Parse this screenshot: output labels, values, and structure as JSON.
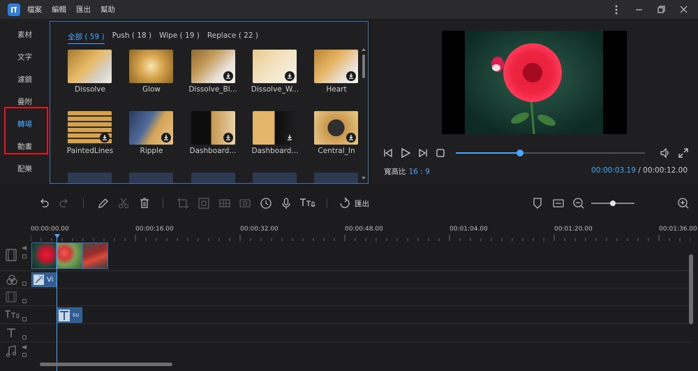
{
  "titlebar": {
    "menu": [
      "檔案",
      "編輯",
      "匯出",
      "幫助"
    ]
  },
  "categories": [
    {
      "label": "素材"
    },
    {
      "label": "文字"
    },
    {
      "label": "濾鏡"
    },
    {
      "label": "疊附"
    },
    {
      "label": "轉場",
      "active": true
    },
    {
      "label": "動畫"
    },
    {
      "label": "配樂"
    }
  ],
  "effects": {
    "tabs": [
      {
        "label": "全部 ( 59 )",
        "active": true
      },
      {
        "label": "Push ( 18 )"
      },
      {
        "label": "Wipe ( 19 )"
      },
      {
        "label": "Replace ( 22 )"
      }
    ],
    "items": [
      {
        "name": "Dissolve",
        "downloadable": false
      },
      {
        "name": "Glow",
        "downloadable": false
      },
      {
        "name": "Dissolve_Bl...",
        "downloadable": true
      },
      {
        "name": "Dissolve_W...",
        "downloadable": true
      },
      {
        "name": "Heart",
        "downloadable": true
      },
      {
        "name": "PaintedLines",
        "downloadable": true
      },
      {
        "name": "Ripple",
        "downloadable": true
      },
      {
        "name": "Dashboard...",
        "downloadable": true
      },
      {
        "name": "Dashboard...",
        "downloadable": true
      },
      {
        "name": "Central_In",
        "downloadable": true
      }
    ]
  },
  "preview": {
    "aspect_label": "寬高比",
    "aspect_value": "16 : 9",
    "current_time": "00:00:03.19",
    "separator": "/",
    "total_time": "00:00:12.00",
    "progress_fraction": 0.34
  },
  "toolbar": {
    "export_label": "匯出",
    "zoom_fraction": 0.5
  },
  "timeline": {
    "ruler_labels": [
      "00:00:00.00",
      "00:00:16.00",
      "00:00:32.00",
      "00:00:48.00",
      "00:01:04.00",
      "00:01:20.00",
      "00:01:36.00"
    ],
    "effect_clip_label": "Vi",
    "text_clip_label": "su"
  },
  "colors": {
    "accent": "#4aa6ff",
    "highlight_box": "#e8141c"
  }
}
